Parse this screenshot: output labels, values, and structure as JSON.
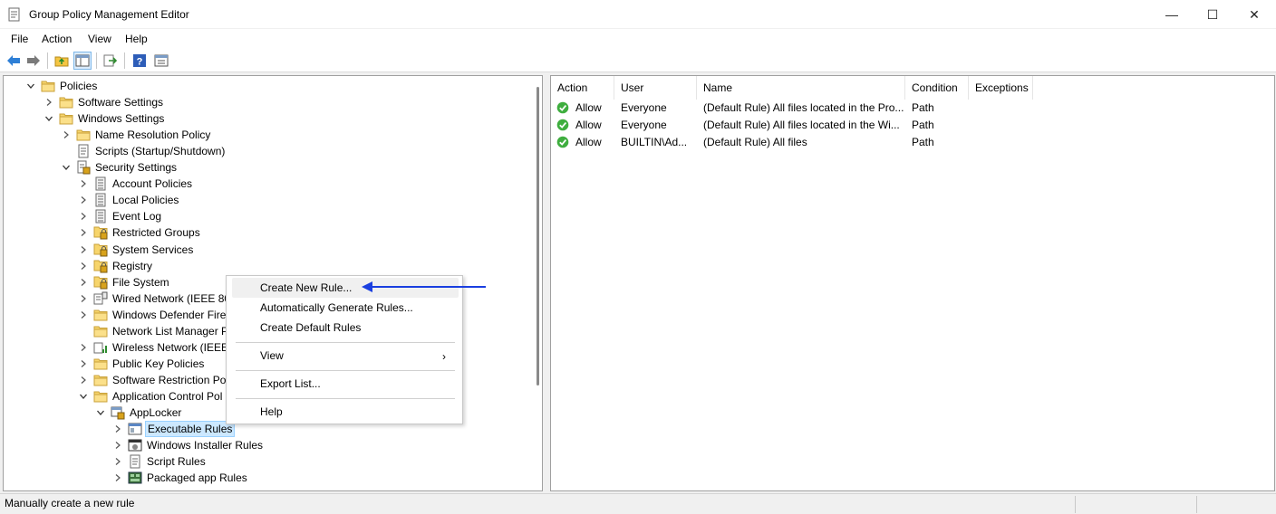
{
  "window": {
    "title": "Group Policy Management Editor",
    "minimize_glyph": "—",
    "maximize_glyph": "☐",
    "close_glyph": "✕"
  },
  "menu": [
    "File",
    "Action",
    "View",
    "Help"
  ],
  "toolbar": {
    "icons": [
      "back-arrow-icon",
      "forward-arrow-icon",
      "up-folder-icon",
      "show-hide-tree-icon",
      "export-list-icon",
      "help-icon",
      "properties-icon"
    ]
  },
  "tree": [
    {
      "label": "Policies",
      "expander": "down",
      "icon": "folder-icon"
    },
    {
      "label": "Software Settings",
      "expander": "right",
      "icon": "folder-icon"
    },
    {
      "label": "Windows Settings",
      "expander": "down",
      "icon": "folder-icon"
    },
    {
      "label": "Name Resolution Policy",
      "expander": "right",
      "icon": "folder-icon"
    },
    {
      "label": "Scripts (Startup/Shutdown)",
      "expander": "none",
      "icon": "script-icon"
    },
    {
      "label": "Security Settings",
      "expander": "down",
      "icon": "security-settings-icon"
    },
    {
      "label": "Account Policies",
      "expander": "right",
      "icon": "policy-sheet-icon"
    },
    {
      "label": "Local Policies",
      "expander": "right",
      "icon": "policy-sheet-icon"
    },
    {
      "label": "Event Log",
      "expander": "right",
      "icon": "policy-sheet-icon"
    },
    {
      "label": "Restricted Groups",
      "expander": "right",
      "icon": "locked-folder-icon"
    },
    {
      "label": "System Services",
      "expander": "right",
      "icon": "locked-folder-icon"
    },
    {
      "label": "Registry",
      "expander": "right",
      "icon": "locked-folder-icon"
    },
    {
      "label": "File System",
      "expander": "right",
      "icon": "locked-folder-icon"
    },
    {
      "label": "Wired Network (IEEE 802",
      "expander": "right",
      "icon": "network-icon"
    },
    {
      "label": "Windows Defender Firew",
      "expander": "right",
      "icon": "folder-icon"
    },
    {
      "label": "Network List Manager P",
      "expander": "none",
      "icon": "folder-icon"
    },
    {
      "label": "Wireless Network (IEEE 8",
      "expander": "right",
      "icon": "wireless-icon"
    },
    {
      "label": "Public Key Policies",
      "expander": "right",
      "icon": "folder-icon"
    },
    {
      "label": "Software Restriction Pol",
      "expander": "right",
      "icon": "folder-icon"
    },
    {
      "label": "Application Control Pol",
      "expander": "down",
      "icon": "folder-icon"
    },
    {
      "label": "AppLocker",
      "expander": "down",
      "icon": "applocker-icon"
    },
    {
      "label": "Executable Rules",
      "expander": "right",
      "icon": "executable-rules-icon",
      "selected": true
    },
    {
      "label": "Windows Installer Rules",
      "expander": "right",
      "icon": "installer-icon"
    },
    {
      "label": "Script Rules",
      "expander": "right",
      "icon": "script-icon"
    },
    {
      "label": "Packaged app Rules",
      "expander": "right",
      "icon": "packaged-app-icon"
    }
  ],
  "list": {
    "columns": [
      "Action",
      "User",
      "Name",
      "Condition",
      "Exceptions"
    ],
    "rows": [
      {
        "action": "Allow",
        "user": "Everyone",
        "name": "(Default Rule) All files located in the Pro...",
        "condition": "Path",
        "exceptions": ""
      },
      {
        "action": "Allow",
        "user": "Everyone",
        "name": "(Default Rule) All files located in the Wi...",
        "condition": "Path",
        "exceptions": ""
      },
      {
        "action": "Allow",
        "user": "BUILTIN\\Ad...",
        "name": "(Default Rule) All files",
        "condition": "Path",
        "exceptions": ""
      }
    ]
  },
  "context_menu": {
    "items": [
      {
        "label": "Create New Rule...",
        "highlighted": true
      },
      {
        "label": "Automatically Generate Rules..."
      },
      {
        "label": "Create Default Rules"
      },
      {
        "label": "View",
        "submenu": true
      },
      {
        "label": "Export List..."
      },
      {
        "label": "Help"
      }
    ],
    "submenu_glyph": "›"
  },
  "status": {
    "text": "Manually create a new rule"
  },
  "colors": {
    "accent": "#1a3fe0",
    "selection": "#cce8ff",
    "folder": "#f5c542"
  }
}
